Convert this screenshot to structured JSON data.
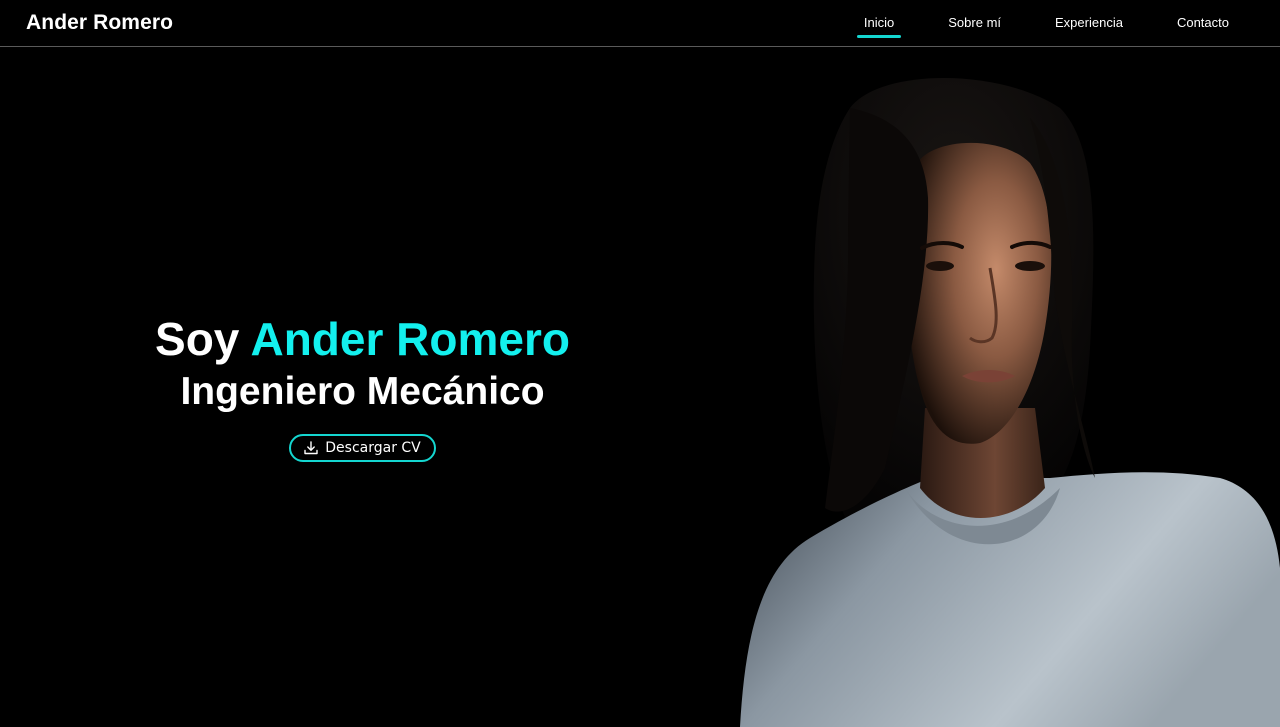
{
  "header": {
    "logo": "Ander Romero",
    "nav": [
      {
        "label": "Inicio",
        "active": true
      },
      {
        "label": "Sobre mí",
        "active": false
      },
      {
        "label": "Experiencia",
        "active": false
      },
      {
        "label": "Contacto",
        "active": false
      }
    ]
  },
  "hero": {
    "greeting": "Soy",
    "name": "Ander Romero",
    "role": "Ingeniero Mecánico",
    "cv_button": "Descargar CV",
    "cv_icon": "download-icon"
  },
  "colors": {
    "background": "#000000",
    "accent": "#13f0ee",
    "button_border": "#14d6d0",
    "text": "#ffffff"
  }
}
